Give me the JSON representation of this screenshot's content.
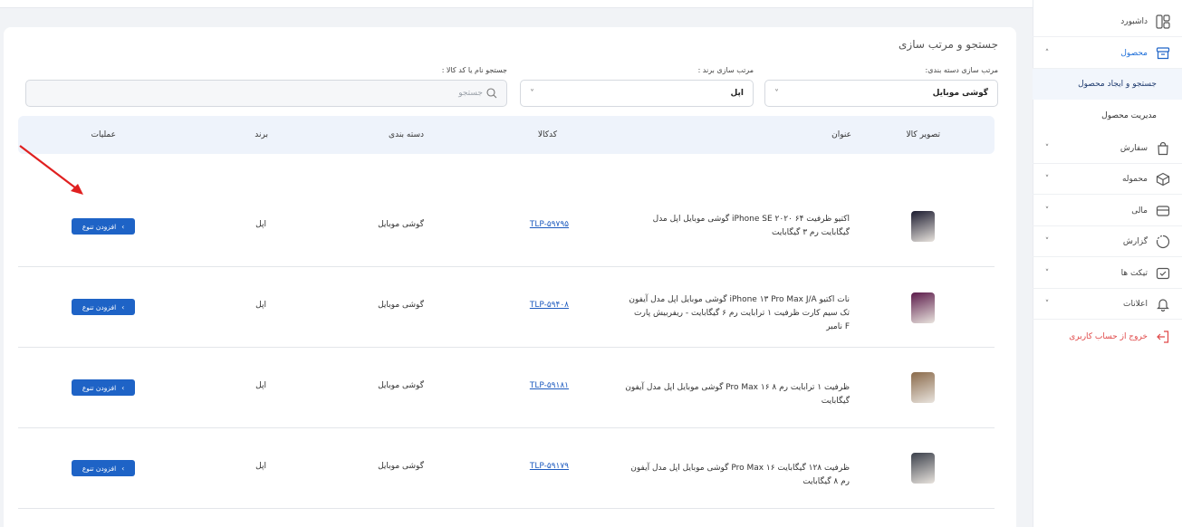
{
  "sidebar": {
    "items": [
      {
        "label": "داشبورد",
        "icon": "dashboard-icon"
      },
      {
        "label": "محصول",
        "icon": "product-box-icon",
        "chevron": "˄"
      },
      {
        "label": "سفارش",
        "icon": "order-bag-icon",
        "chevron": "˅"
      },
      {
        "label": "محموله",
        "icon": "shipment-icon",
        "chevron": "˅"
      },
      {
        "label": "مالی",
        "icon": "wallet-icon",
        "chevron": "˅"
      },
      {
        "label": "گزارش",
        "icon": "report-chart-icon",
        "chevron": "˅"
      },
      {
        "label": "تیکت ها",
        "icon": "ticket-icon",
        "chevron": "˅"
      },
      {
        "label": "اعلانات",
        "icon": "bell-icon",
        "chevron": "˅"
      }
    ],
    "sub_items": [
      "جستجو و ایجاد محصول",
      "مدیریت محصول"
    ],
    "logout": "خروج از حساب کاربری"
  },
  "card": {
    "title": "جستجو و مرتب سازی"
  },
  "filters": {
    "category": {
      "label": "مرتب سازی دسته بندی:",
      "value": "گوشی موبایل",
      "chevron": "˅"
    },
    "brand": {
      "label": "مرتب سازی برند :",
      "value": "اپل",
      "chevron": "˅"
    },
    "search": {
      "label": "جستجو نام یا کد کالا :",
      "placeholder": "جستجو"
    }
  },
  "table": {
    "headers": {
      "image": "تصویر کالا",
      "title": "عنوان",
      "code": "کدکالا",
      "category": "دسته بندی",
      "brand": "برند",
      "actions": "عملیات"
    },
    "rows": [
      {
        "title": "گوشی موبایل اپل مدل iPhone SE ۲۰۲۰ اکتیو ظرفیت ۶۴ گیگابایت رم ۳ گیگابایت",
        "code": "TLP-۵۹۷۹۵",
        "category": "گوشی موبایل",
        "brand": "اپل",
        "action": "افزودن تنوع",
        "action_icon": "‹",
        "thumb_color": "#1a1a2e"
      },
      {
        "title": "گوشی موبایل اپل مدل آیفون iPhone ۱۳ Pro Max J/A نات اکتیو تک سیم کارت ظرفیت ۱ ترابایت رم ۶ گیگابایت - ریفربیش پارت نامبر F",
        "code": "TLP-۵۹۴۰۸",
        "category": "گوشی موبایل",
        "brand": "اپل",
        "action": "افزودن تنوع",
        "action_icon": "‹",
        "thumb_color": "#5b1a4a"
      },
      {
        "title": "گوشی موبایل اپل مدل آیفون Pro Max ۱۶ ظرفیت ۱ ترابایت رم ۸ گیگابایت",
        "code": "TLP-۵۹۱۸۱",
        "category": "گوشی موبایل",
        "brand": "اپل",
        "action": "افزودن تنوع",
        "action_icon": "‹",
        "thumb_color": "#8a6a4a"
      },
      {
        "title": "گوشی موبایل اپل مدل آیفون Pro Max ۱۶ ظرفیت ۱۲۸ گیگابایت رم ۸ گیگابایت",
        "code": "TLP-۵۹۱۷۹",
        "category": "گوشی موبایل",
        "brand": "اپل",
        "action": "افزودن تنوع",
        "action_icon": "‹",
        "thumb_color": "#3a3f4a"
      }
    ]
  },
  "colors": {
    "accent": "#1e63c6",
    "logout": "#e04848",
    "annotation_arrow": "#e02020"
  }
}
